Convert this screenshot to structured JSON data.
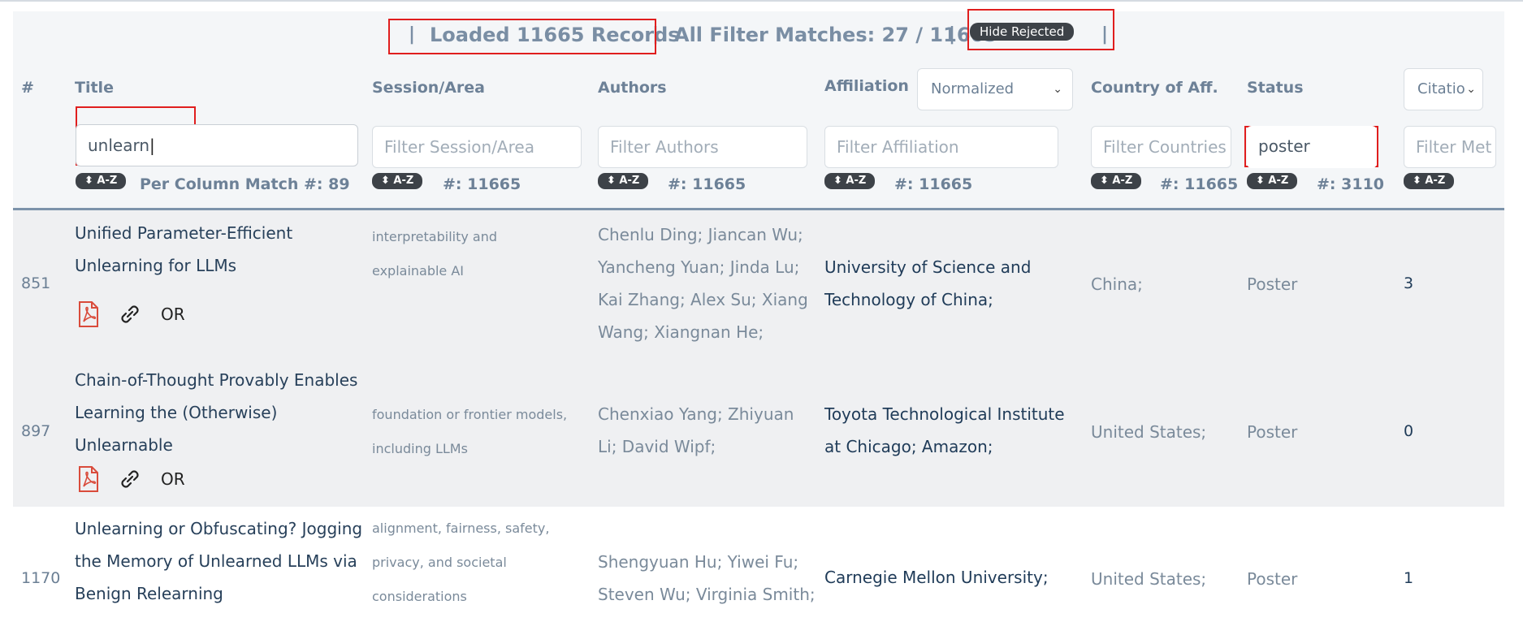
{
  "summary": {
    "sep1": "|",
    "loaded": "Loaded 11665 Records",
    "sep2": "|",
    "matches": "All Filter Matches: 27 / 11665",
    "sep3": "|",
    "hide_rejected": "Hide Rejected",
    "sep4": "|"
  },
  "columns": {
    "num": "#",
    "title": "Title",
    "session": "Session/Area",
    "authors": "Authors",
    "affiliation": "Affiliation",
    "affiliation_mode": "Normalized",
    "country": "Country of Aff.",
    "status": "Status",
    "citation_select": "Citatio"
  },
  "filters": {
    "title_value": "unlearn",
    "session_placeholder": "Filter Session/Area",
    "authors_placeholder": "Filter Authors",
    "affiliation_placeholder": "Filter Affiliation",
    "countries_placeholder": "Filter Countries",
    "status_value": "poster",
    "metric_placeholder": "Filter Met"
  },
  "sort_label": "⬍ A-Z",
  "counts": {
    "title": "Per Column Match  #: 89",
    "session": "#: 11665",
    "authors": "#: 11665",
    "affiliation": "#: 11665",
    "country": "#: 11665",
    "status": "#: 3110"
  },
  "rows": [
    {
      "num": "851",
      "title": "Unified Parameter-Efficient Unlearning for LLMs",
      "or_label": "OR",
      "session": "interpretability and explainable AI",
      "authors": "Chenlu Ding; Jiancan Wu; Yancheng Yuan; Jinda Lu; Kai Zhang; Alex Su; Xiang Wang; Xiangnan He;",
      "affiliation": "University of Science and Technology of China;",
      "country": "China;",
      "status": "Poster",
      "citations": "3"
    },
    {
      "num": "897",
      "title": "Chain-of-Thought Provably Enables Learning the (Otherwise) Unlearnable",
      "or_label": "OR",
      "session": "foundation or frontier models, including LLMs",
      "authors": "Chenxiao Yang; Zhiyuan Li; David Wipf;",
      "affiliation": "Toyota Technological Institute at Chicago; Amazon;",
      "country": "United States;",
      "status": "Poster",
      "citations": "0"
    },
    {
      "num": "1170",
      "title": "Unlearning or Obfuscating? Jogging the Memory of Unlearned LLMs via Benign Relearning",
      "session": "alignment, fairness, safety, privacy, and societal considerations",
      "authors": "Shengyuan Hu; Yiwei Fu; Steven Wu; Virginia Smith;",
      "affiliation": "Carnegie Mellon University;",
      "country": "United States;",
      "status": "Poster",
      "citations": "1"
    }
  ],
  "colors": {
    "highlight": "#e01e1e",
    "header_text": "#6d8197",
    "badge_bg": "#3d4248",
    "pdf_icon": "#d94b3b",
    "link_text": "#1f3b58"
  },
  "icons": [
    "pdf-icon",
    "link-icon",
    "chevron-down-icon"
  ]
}
